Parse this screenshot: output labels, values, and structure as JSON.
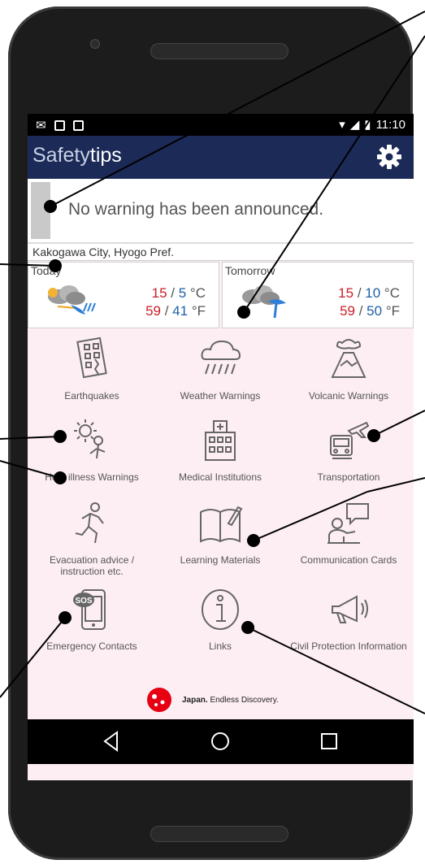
{
  "status": {
    "time": "11:10"
  },
  "app": {
    "title_light": "Safety",
    "title_bold": "tips",
    "settings_icon": "gear-icon"
  },
  "warning": {
    "text": "No warning has been announced."
  },
  "location": "Kakogawa City, Hyogo Pref.",
  "forecast": [
    {
      "label": "Today",
      "hi_c": "15",
      "lo_c": "5",
      "unit_c": "°C",
      "hi_f": "59",
      "lo_f": "41",
      "unit_f": "°F",
      "icon": "cloud-rain-wind-icon"
    },
    {
      "label": "Tomorrow",
      "hi_c": "15",
      "lo_c": "10",
      "unit_c": "°C",
      "hi_f": "59",
      "lo_f": "50",
      "unit_f": "°F",
      "icon": "cloud-umbrella-icon"
    }
  ],
  "menu": [
    {
      "label": "Earthquakes",
      "icon": "earthquake-icon"
    },
    {
      "label": "Weather Warnings",
      "icon": "rain-cloud-icon"
    },
    {
      "label": "Volcanic Warnings",
      "icon": "volcano-icon"
    },
    {
      "label": "Heat illness Warnings",
      "icon": "heat-icon"
    },
    {
      "label": "Medical Institutions",
      "icon": "hospital-icon"
    },
    {
      "label": "Transportation",
      "icon": "transport-icon"
    },
    {
      "label": "Evacuation advice / instruction etc.",
      "icon": "running-person-icon"
    },
    {
      "label": "Learning Materials",
      "icon": "book-icon"
    },
    {
      "label": "Communication Cards",
      "icon": "speech-person-icon"
    },
    {
      "label": "Emergency Contacts",
      "icon": "sos-phone-icon"
    },
    {
      "label": "Links",
      "icon": "info-icon"
    },
    {
      "label": "Civil Protection Information",
      "icon": "megaphone-icon"
    }
  ],
  "logo": {
    "bold": "Japan.",
    "rest": "Endless Discovery."
  }
}
